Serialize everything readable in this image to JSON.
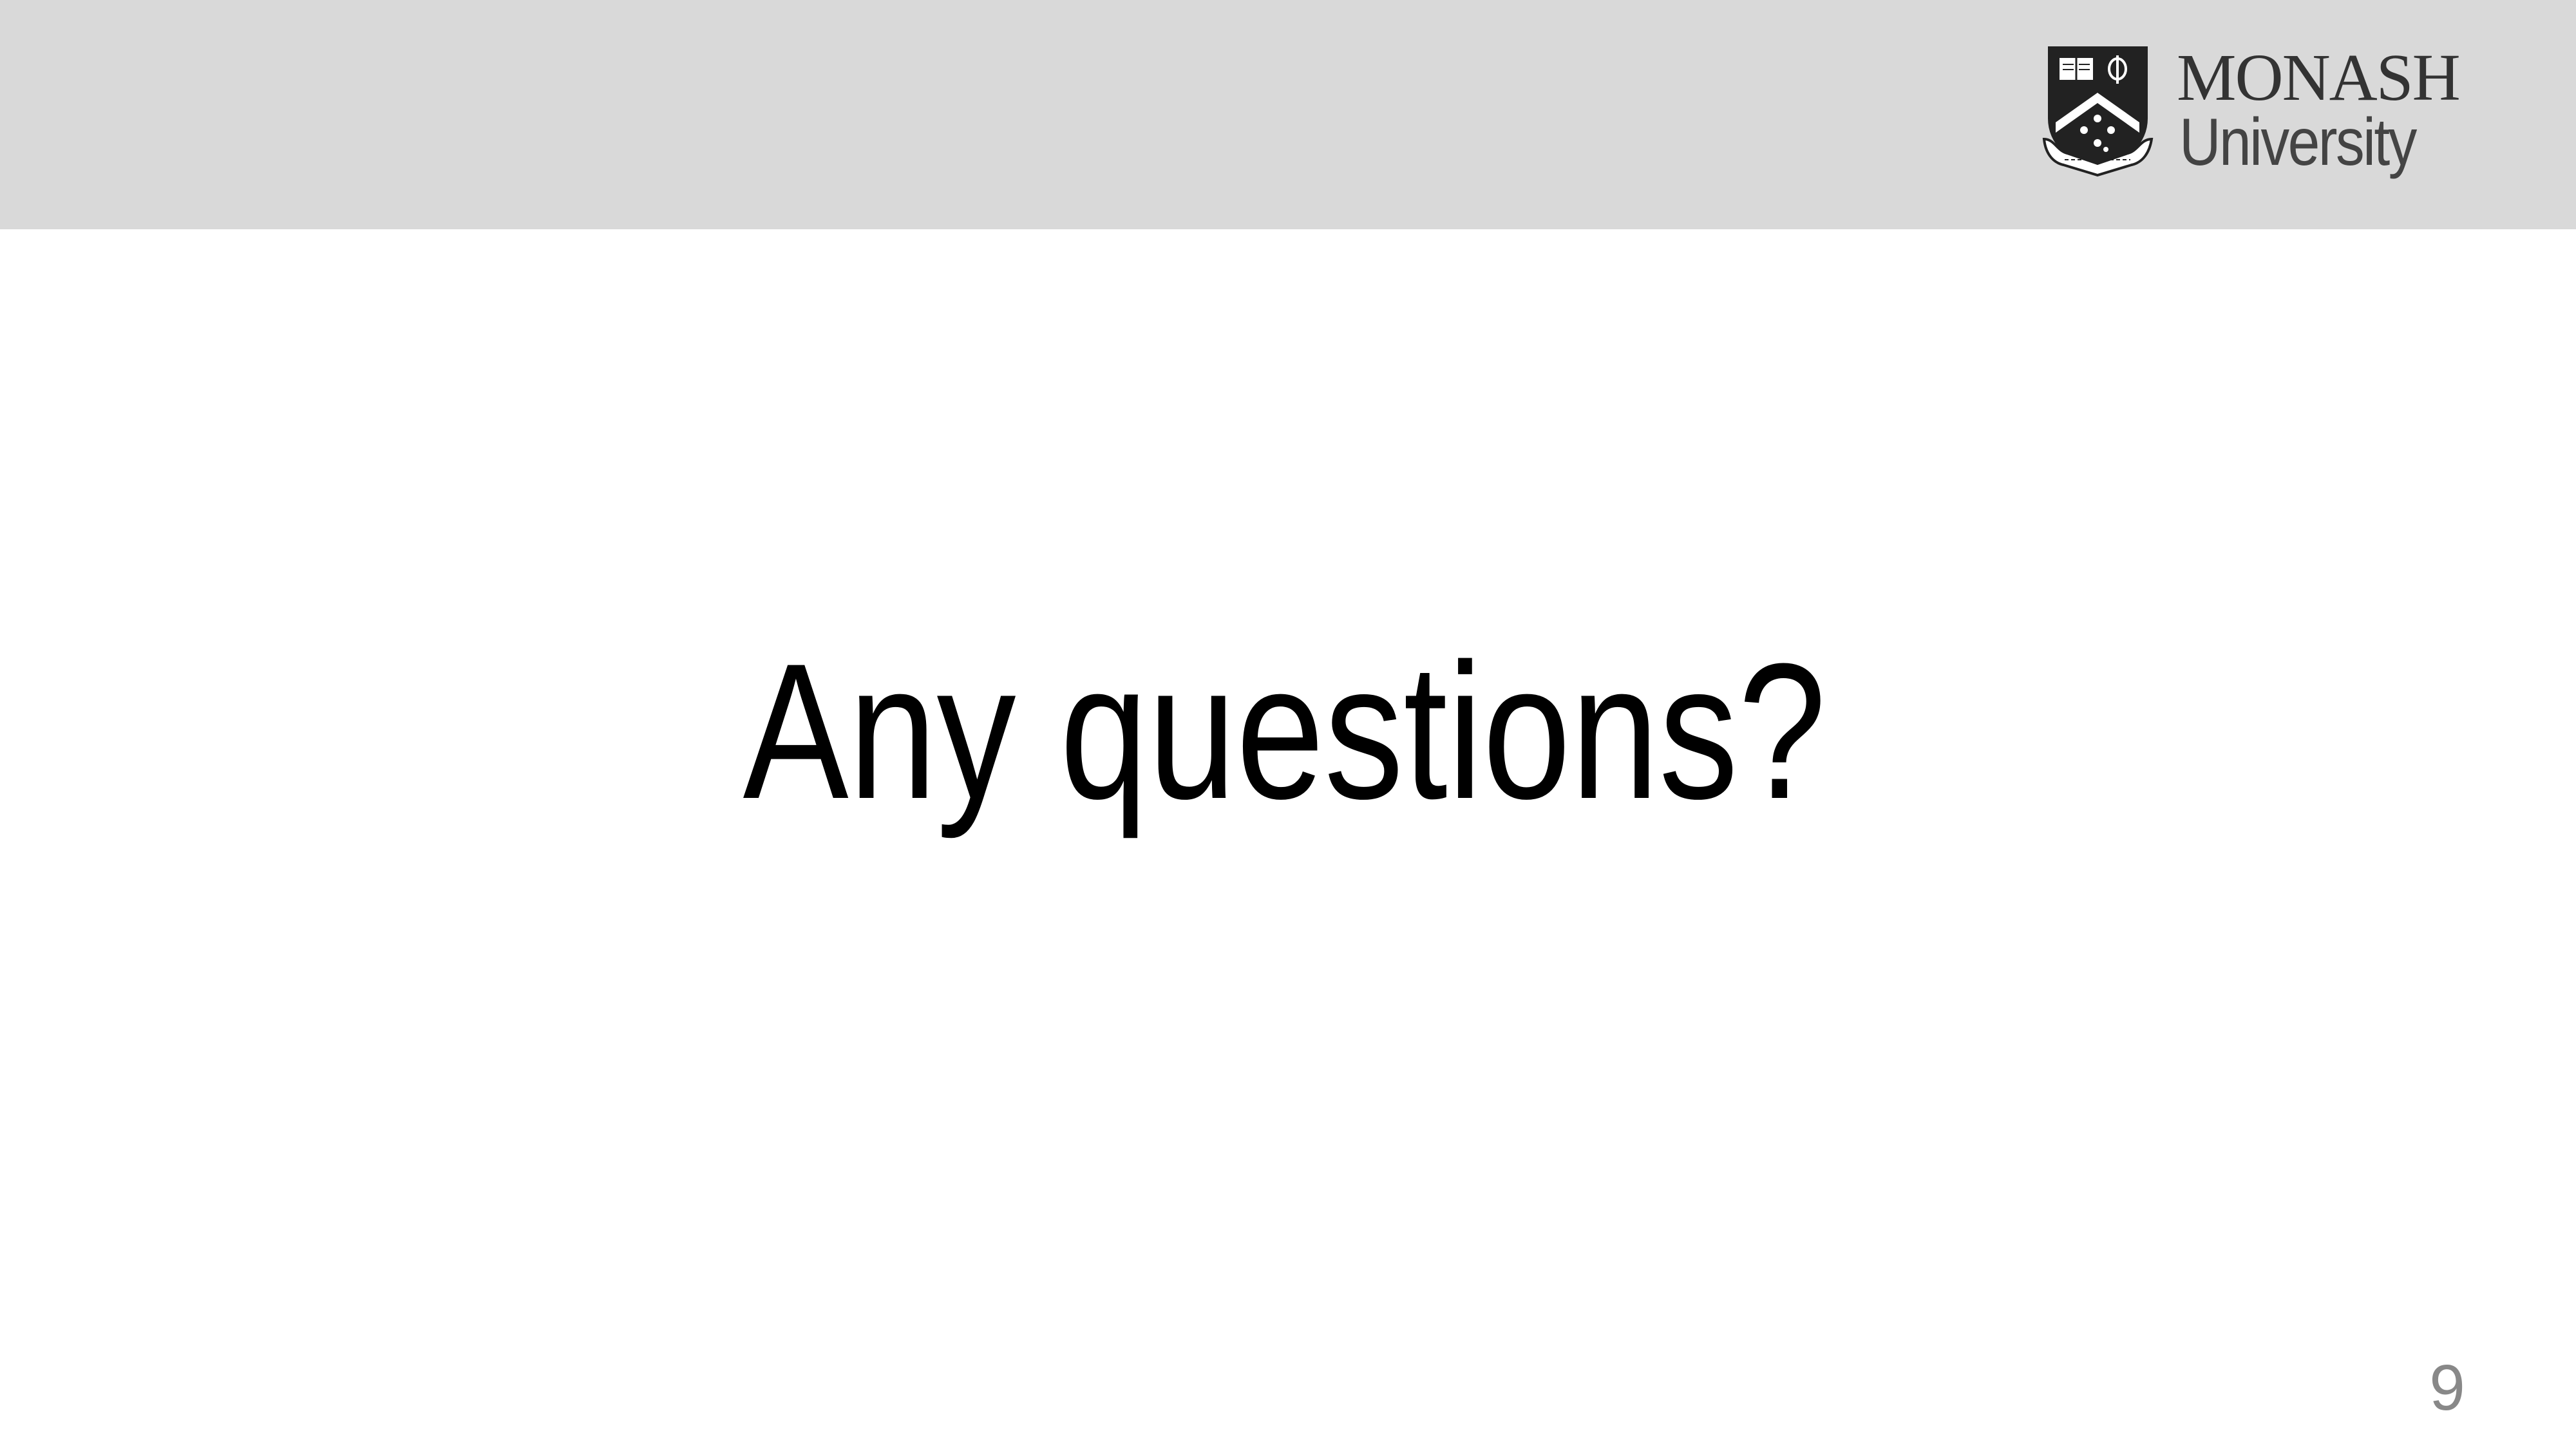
{
  "header": {
    "logo": {
      "line1": "MONASH",
      "line2": "University",
      "crest_icon": "monash-crest-icon",
      "crest_motto": "ANCORA IMPARO"
    }
  },
  "slide": {
    "title": "Any questions?",
    "page_number": "9"
  },
  "colors": {
    "header_bar": "#d9d9d9",
    "title_text": "#000000",
    "page_number_text": "#888888",
    "logo_text": "#333333"
  }
}
